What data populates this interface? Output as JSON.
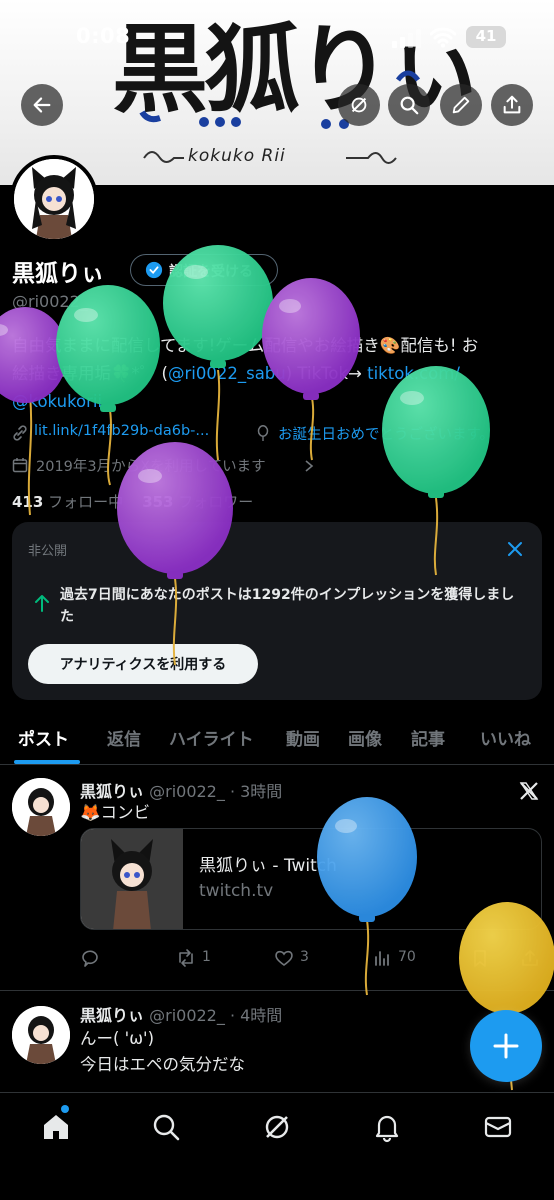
{
  "status_bar": {
    "time": "0:08",
    "battery": "41"
  },
  "banner": {
    "logo_text": "黒狐りぃ",
    "logo_subtext": "kokuko Rii"
  },
  "profile": {
    "name": "黒狐りぃ",
    "verify_label": "認証を受ける",
    "handle": "@ri0022_",
    "bio_line1": "自由気ままに配信してます!ゲーム配信やお絵描き🎨配信も! お",
    "bio_line2_a": "絵描き専用垢🍀*゜ (",
    "bio_line2_link": "@ri0022_sabu",
    "bio_line2_b": ") TikTok→ ",
    "bio_line2_url": "tiktok.com/",
    "bio_line3": "@kokukorii",
    "link": "lit.link/1f4fb29b-da6b-...",
    "birthday": "お誕生日おめでとうございます。",
    "joined": "2019年3月からXを利用しています",
    "following_count": "413",
    "following_label": "フォロー中",
    "followers_count": "353",
    "followers_label": "フォロワー"
  },
  "analytics": {
    "label": "非公開",
    "message": "過去7日間にあなたのポストは1292件のインプレッションを獲得しました",
    "cta": "アナリティクスを利用する"
  },
  "tabs": [
    "ポスト",
    "返信",
    "ハイライト",
    "動画",
    "画像",
    "記事",
    "いいね"
  ],
  "posts": [
    {
      "author": "黒狐りぃ",
      "handle_time": "@ri0022_ · 3時間",
      "text": "🦊コンビ",
      "card_title": "黒狐りぃ - Twitch",
      "card_domain": "twitch.tv",
      "replies": "",
      "reposts": "1",
      "likes": "3",
      "views": "70"
    },
    {
      "author": "黒狐りぃ",
      "handle_time": "@ri0022_ · 4時間",
      "text_line1": "んー( 'ω')",
      "text_line2": "今日はエペの気分だな"
    }
  ],
  "colors": {
    "accent": "#1d9bf0",
    "background": "#000000",
    "card": "#16181c",
    "muted": "#71767b"
  }
}
